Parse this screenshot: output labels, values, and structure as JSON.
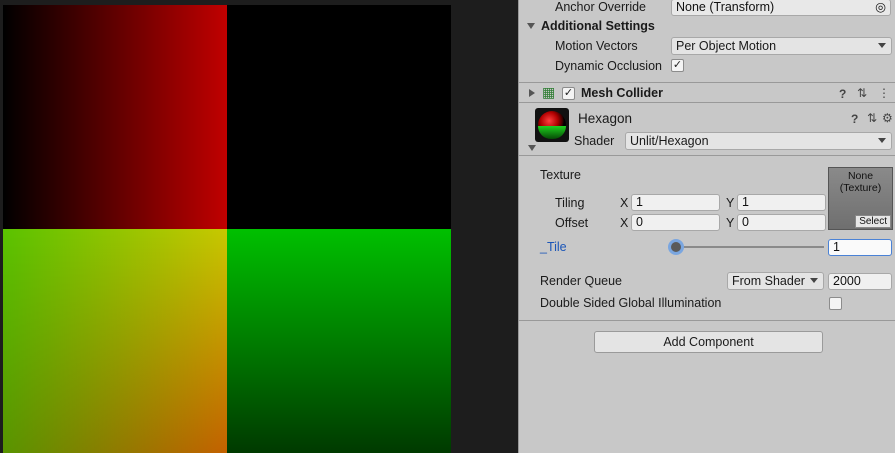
{
  "scene": {
    "quadrant_colors": {
      "top_left": "#c00000",
      "top_right": "#000000",
      "bottom_left": "#c8c800",
      "bottom_right": "#00c000"
    }
  },
  "mesh_renderer": {
    "anchor_override_label": "Anchor Override",
    "anchor_override_value": "None (Transform)",
    "additional_settings_label": "Additional Settings",
    "motion_vectors_label": "Motion Vectors",
    "motion_vectors_value": "Per Object Motion",
    "dynamic_occlusion_label": "Dynamic Occlusion",
    "dynamic_occlusion_checked": "✓"
  },
  "mesh_collider": {
    "title": "Mesh Collider",
    "enabled_mark": "✓"
  },
  "material": {
    "name": "Hexagon",
    "shader_label": "Shader",
    "shader_value": "Unlit/Hexagon",
    "texture_label": "Texture",
    "tiling_label": "Tiling",
    "offset_label": "Offset",
    "x_label": "X",
    "y_label": "Y",
    "tiling_x": "1",
    "tiling_y": "1",
    "offset_x": "0",
    "offset_y": "0",
    "texture_none": "None",
    "texture_type": "(Texture)",
    "texture_select": "Select",
    "tile_label": "_Tile",
    "tile_value": "1",
    "tile_slider_fraction": 0,
    "render_queue_label": "Render Queue",
    "render_queue_mode": "From Shader",
    "render_queue_value": "2000",
    "dsgi_label": "Double Sided Global Illumination"
  },
  "add_component_label": "Add Component",
  "icons": {
    "help": "?",
    "presets": "⇅",
    "menu": "⋮",
    "settings": "⚙",
    "target": "◎",
    "grid": "▦"
  }
}
